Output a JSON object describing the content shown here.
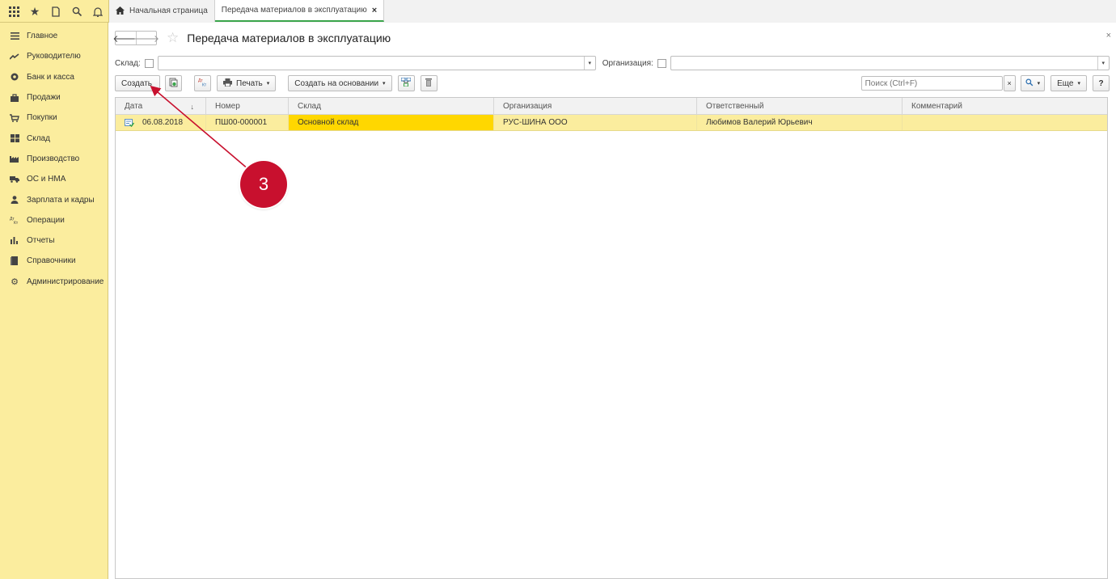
{
  "topbar": {
    "icons": [
      "apps-grid-icon",
      "favorites-star-icon",
      "history-icon",
      "search-icon",
      "notifications-bell-icon"
    ],
    "tabs": [
      {
        "label": "Начальная страница"
      },
      {
        "label": "Передача материалов в эксплуатацию",
        "active": true
      }
    ]
  },
  "sidebar": {
    "items": [
      {
        "label": "Главное",
        "icon": "menu-lines-icon"
      },
      {
        "label": "Руководителю",
        "icon": "trend-chart-icon"
      },
      {
        "label": "Банк и касса",
        "icon": "coin-icon"
      },
      {
        "label": "Продажи",
        "icon": "shopping-bag-icon"
      },
      {
        "label": "Покупки",
        "icon": "cart-icon"
      },
      {
        "label": "Склад",
        "icon": "warehouse-grid-icon"
      },
      {
        "label": "Производство",
        "icon": "factory-icon"
      },
      {
        "label": "ОС и НМА",
        "icon": "truck-icon"
      },
      {
        "label": "Зарплата и кадры",
        "icon": "person-icon"
      },
      {
        "label": "Операции",
        "icon": "operations-icon"
      },
      {
        "label": "Отчеты",
        "icon": "bar-chart-icon"
      },
      {
        "label": "Справочники",
        "icon": "book-icon"
      },
      {
        "label": "Администрирование",
        "icon": "gear-icon"
      }
    ]
  },
  "form": {
    "title": "Передача материалов в эксплуатацию",
    "filters": {
      "warehouse_label": "Склад:",
      "warehouse_value": "",
      "organization_label": "Организация:",
      "organization_value": ""
    },
    "toolbar": {
      "create_label": "Создать",
      "print_label": "Печать",
      "create_based_label": "Создать на основании",
      "search_placeholder": "Поиск (Ctrl+F)",
      "more_label": "Еще",
      "help_label": "?"
    },
    "table": {
      "columns": [
        "Дата",
        "Номер",
        "Склад",
        "Организация",
        "Ответственный",
        "Комментарий"
      ],
      "rows": [
        [
          "06.08.2018",
          "ПШ00-000001",
          "Основной склад",
          "РУС-ШИНА ООО",
          "Любимов Валерий Юрьевич",
          ""
        ]
      ]
    }
  },
  "annotation": {
    "badge": "3",
    "color": "#c8102e"
  }
}
